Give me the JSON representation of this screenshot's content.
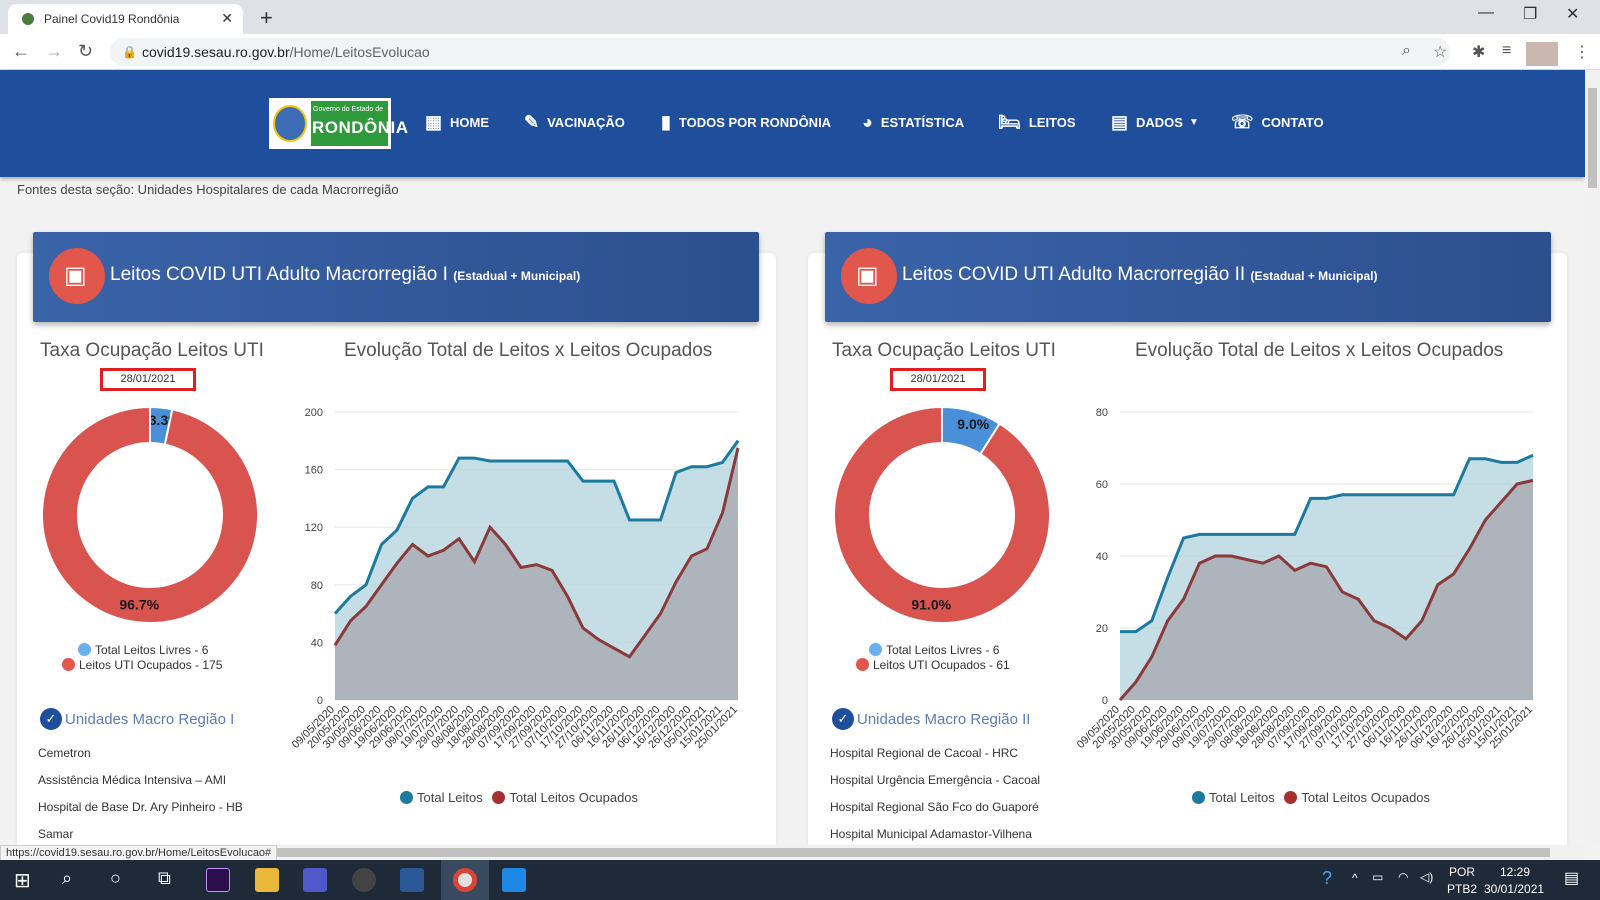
{
  "browser": {
    "tab_title": "Painel Covid19 Rondônia",
    "url_host": "covid19.sesau.ro.gov.br",
    "url_path": "/Home/LeitosEvolucao",
    "status_url": "https://covid19.sesau.ro.gov.br/Home/LeitosEvolucao#"
  },
  "logo": {
    "small": "Governo do Estado de",
    "big": "RONDÔNIA"
  },
  "nav": [
    "HOME",
    "VACINAÇÃO",
    "TODOS POR RONDÔNIA",
    "ESTATÍSTICA",
    "LEITOS",
    "DADOS",
    "CONTATO"
  ],
  "fontes": "Fontes desta seção: Unidades Hospitalares de cada Macrorregião",
  "panels": [
    {
      "title": "Leitos COVID UTI Adulto Macrorregião I",
      "subtitle": "(Estadual + Municipal)",
      "donut_title": "Taxa Ocupação Leitos UTI",
      "date": "28/01/2021",
      "free_pct_label": "3.3%",
      "occ_pct_label": "96.7%",
      "free_label": "Total Leitos Livres - 6",
      "occ_label": "Leitos UTI Ocupados - 175",
      "line_title": "Evolução Total de Leitos x Leitos Ocupados",
      "units_title": "Unidades Macro Região I",
      "units": [
        "Cemetron",
        "Assistência Médica Intensiva – AMI",
        "Hospital de Base Dr. Ary Pinheiro - HB",
        "Samar"
      ],
      "legend_total": "Total Leitos",
      "legend_occ": "Total Leitos Ocupados"
    },
    {
      "title": "Leitos COVID UTI Adulto Macrorregião II",
      "subtitle": "(Estadual + Municipal)",
      "donut_title": "Taxa Ocupação Leitos UTI",
      "date": "28/01/2021",
      "free_pct_label": "9.0%",
      "occ_pct_label": "91.0%",
      "free_label": "Total Leitos Livres - 6",
      "occ_label": "Leitos UTI Ocupados - 61",
      "line_title": "Evolução Total de Leitos x Leitos Ocupados",
      "units_title": "Unidades Macro Região II",
      "units": [
        "Hospital Regional de Cacoal - HRC",
        "Hospital Urgência Emergência - Cacoal",
        "Hospital Regional São Fco do Guaporé",
        "Hospital Municipal Adamastor-Vilhena"
      ],
      "legend_total": "Total Leitos",
      "legend_occ": "Total Leitos Ocupados"
    }
  ],
  "taskbar": {
    "lang1": "POR",
    "lang2": "PTB2",
    "time": "12:29",
    "date": "30/01/2021"
  },
  "colors": {
    "nav_bg": "#1f4f9c",
    "total": "#1b7a9e",
    "occupied": "#8a3a3a",
    "free": "#4a90d9",
    "occ_slice": "#d9534f"
  },
  "chart_data": [
    {
      "type": "pie",
      "labels": [
        "Total Leitos Livres",
        "Leitos UTI Ocupados"
      ],
      "values": [
        6,
        175
      ],
      "percent_labels": [
        "3.3%",
        "96.7%"
      ]
    },
    {
      "type": "line",
      "title": "Evolução Total de Leitos x Leitos Ocupados",
      "x": [
        "09/05/2020",
        "20/05/2020",
        "30/05/2020",
        "09/06/2020",
        "19/06/2020",
        "29/06/2020",
        "09/07/2020",
        "19/07/2020",
        "29/07/2020",
        "08/08/2020",
        "18/08/2020",
        "28/08/2020",
        "07/09/2020",
        "17/09/2020",
        "27/09/2020",
        "07/10/2020",
        "17/10/2020",
        "27/10/2020",
        "06/11/2020",
        "16/11/2020",
        "26/11/2020",
        "06/12/2020",
        "16/12/2020",
        "26/12/2020",
        "05/01/2021",
        "15/01/2021",
        "25/01/2021"
      ],
      "ylim": [
        0,
        200
      ],
      "yticks": [
        0,
        40,
        80,
        120,
        160,
        200
      ],
      "series": [
        {
          "name": "Total Leitos",
          "values": [
            60,
            72,
            80,
            108,
            118,
            140,
            148,
            148,
            168,
            168,
            166,
            166,
            166,
            166,
            166,
            166,
            152,
            152,
            152,
            125,
            125,
            125,
            158,
            162,
            162,
            165,
            180
          ]
        },
        {
          "name": "Total Leitos Ocupados",
          "values": [
            38,
            55,
            65,
            80,
            95,
            108,
            100,
            104,
            112,
            96,
            120,
            108,
            92,
            94,
            90,
            72,
            50,
            42,
            36,
            30,
            45,
            60,
            82,
            100,
            105,
            130,
            175
          ]
        }
      ]
    },
    {
      "type": "pie",
      "labels": [
        "Total Leitos Livres",
        "Leitos UTI Ocupados"
      ],
      "values": [
        6,
        61
      ],
      "percent_labels": [
        "9.0%",
        "91.0%"
      ]
    },
    {
      "type": "line",
      "title": "Evolução Total de Leitos x Leitos Ocupados",
      "x": [
        "09/05/2020",
        "20/05/2020",
        "30/05/2020",
        "09/06/2020",
        "19/06/2020",
        "29/06/2020",
        "09/07/2020",
        "19/07/2020",
        "29/07/2020",
        "08/08/2020",
        "18/08/2020",
        "28/08/2020",
        "07/09/2020",
        "17/09/2020",
        "27/09/2020",
        "07/10/2020",
        "17/10/2020",
        "27/10/2020",
        "06/11/2020",
        "16/11/2020",
        "26/11/2020",
        "06/12/2020",
        "16/12/2020",
        "26/12/2020",
        "05/01/2021",
        "15/01/2021",
        "25/01/2021"
      ],
      "ylim": [
        0,
        80
      ],
      "yticks": [
        0,
        20,
        40,
        60,
        80
      ],
      "series": [
        {
          "name": "Total Leitos",
          "values": [
            19,
            19,
            22,
            34,
            45,
            46,
            46,
            46,
            46,
            46,
            46,
            46,
            56,
            56,
            57,
            57,
            57,
            57,
            57,
            57,
            57,
            57,
            67,
            67,
            66,
            66,
            68
          ]
        },
        {
          "name": "Total Leitos Ocupados",
          "values": [
            0,
            5,
            12,
            22,
            28,
            38,
            40,
            40,
            39,
            38,
            40,
            36,
            38,
            37,
            30,
            28,
            22,
            20,
            17,
            22,
            32,
            35,
            42,
            50,
            55,
            60,
            61
          ]
        }
      ]
    }
  ]
}
